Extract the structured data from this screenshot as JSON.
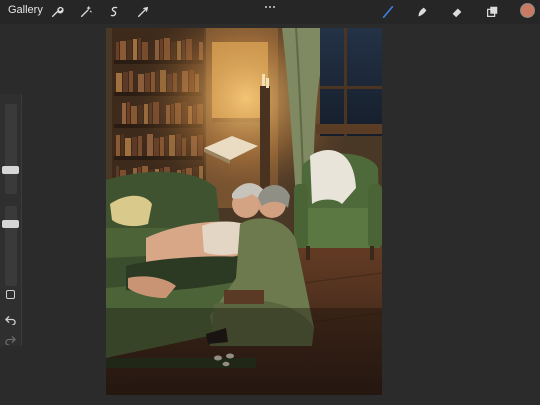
{
  "toolbar": {
    "gallery_label": "Gallery",
    "left_tools": [
      "wrench-icon",
      "magic-wand-icon",
      "selection-icon",
      "transform-icon"
    ],
    "right_tools": [
      "brush-icon",
      "smudge-icon",
      "eraser-icon",
      "layers-icon"
    ],
    "brush_active_color": "#3d7bd9",
    "current_color": "#c97a62"
  },
  "sidebar": {
    "brush_size": 0.25,
    "opacity": 0.8
  },
  "canvas": {
    "subject": "painting"
  }
}
